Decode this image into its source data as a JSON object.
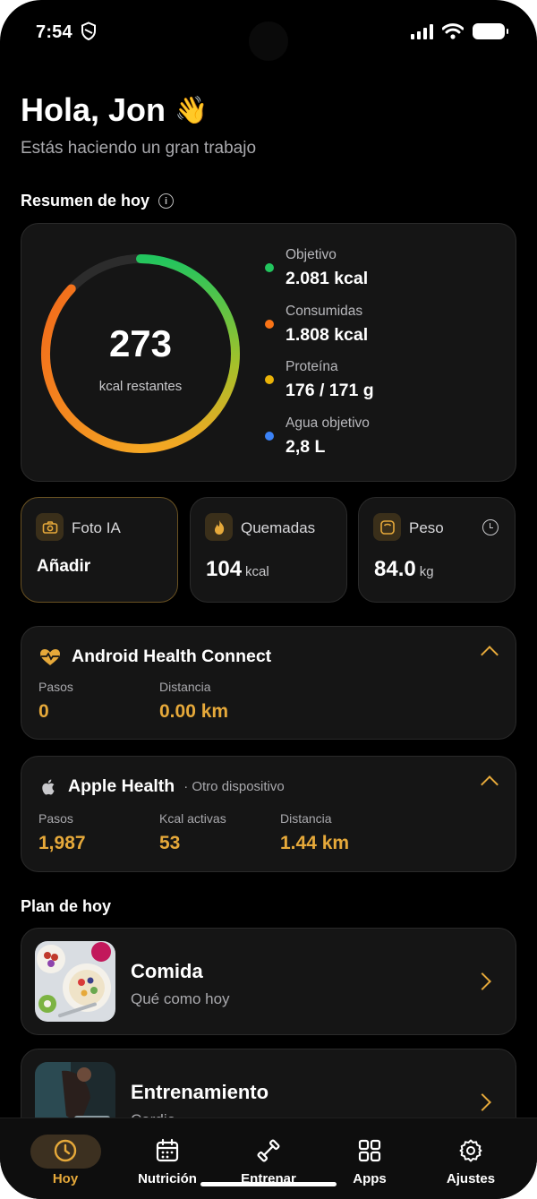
{
  "status_bar": {
    "time": "7:54"
  },
  "header": {
    "greeting": "Hola, Jon",
    "wave": "👋",
    "subtitle": "Estás haciendo un gran trabajo"
  },
  "summary": {
    "title": "Resumen de hoy",
    "ring_value": "273",
    "ring_label": "kcal restantes",
    "ring_progress": 0.87,
    "legend": [
      {
        "label": "Objetivo",
        "value": "2.081 kcal",
        "color": "#22c55e"
      },
      {
        "label": "Consumidas",
        "value": "1.808 kcal",
        "color": "#f97316"
      },
      {
        "label": "Proteína",
        "value": "176 / 171 g",
        "color": "#eab308"
      },
      {
        "label": "Agua objetivo",
        "value": "2,8 L",
        "color": "#3b82f6"
      }
    ]
  },
  "mini_cards": {
    "photo": {
      "title": "Foto IA",
      "action": "Añadir",
      "icon": "camera-icon"
    },
    "burned": {
      "title": "Quemadas",
      "value": "104",
      "unit": "kcal",
      "icon": "flame-icon"
    },
    "weight": {
      "title": "Peso",
      "value": "84.0",
      "unit": "kg",
      "icon": "scale-icon"
    }
  },
  "android_health": {
    "name": "Android Health Connect",
    "stats": [
      {
        "label": "Pasos",
        "value": "0"
      },
      {
        "label": "Distancia",
        "value": "0.00 km"
      }
    ]
  },
  "apple_health": {
    "name": "Apple Health",
    "sub": "· Otro dispositivo",
    "stats": [
      {
        "label": "Pasos",
        "value": "1,987"
      },
      {
        "label": "Kcal activas",
        "value": "53"
      },
      {
        "label": "Distancia",
        "value": "1.44 km"
      }
    ]
  },
  "plan": {
    "title": "Plan de hoy",
    "items": [
      {
        "title": "Comida",
        "subtitle": "Qué como hoy"
      },
      {
        "title": "Entrenamiento",
        "subtitle": "Cardio"
      }
    ]
  },
  "nav": {
    "items": [
      {
        "label": "Hoy",
        "icon": "today-icon",
        "active": true
      },
      {
        "label": "Nutrición",
        "icon": "calendar-icon"
      },
      {
        "label": "Entrenar",
        "icon": "dumbbell-icon"
      },
      {
        "label": "Apps",
        "icon": "apps-grid-icon"
      },
      {
        "label": "Ajustes",
        "icon": "gear-icon"
      }
    ]
  },
  "colors": {
    "accent": "#e6a93a",
    "background": "#000000",
    "card": "#151515"
  }
}
